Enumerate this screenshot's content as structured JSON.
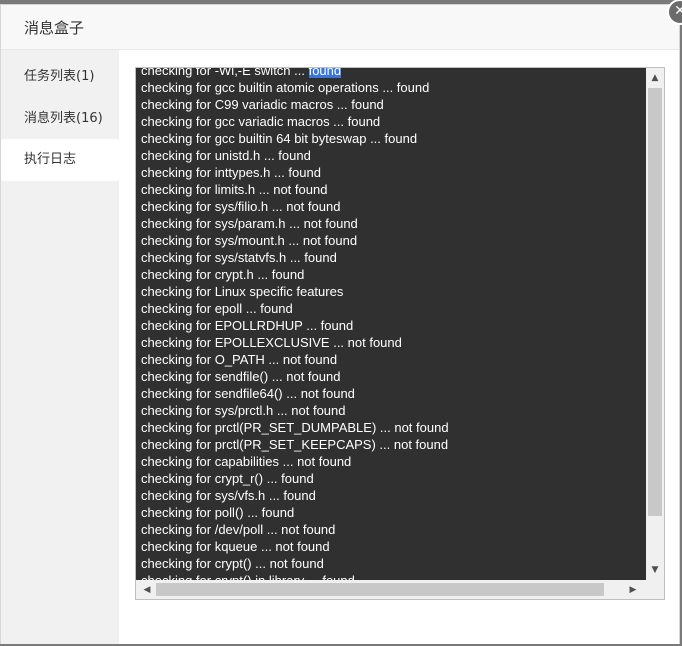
{
  "dialog": {
    "title": "消息盒子",
    "close_glyph": "✕"
  },
  "sidebar": {
    "items": [
      {
        "label": "任务列表(1)",
        "active": false
      },
      {
        "label": "消息列表(16)",
        "active": false
      },
      {
        "label": "执行日志",
        "active": true
      }
    ]
  },
  "log": {
    "partial_top_line": {
      "text": "checking for -Wl,-E switch ... ",
      "highlighted": "found"
    },
    "lines": [
      "checking for gcc builtin atomic operations ... found",
      "checking for C99 variadic macros ... found",
      "checking for gcc variadic macros ... found",
      "checking for gcc builtin 64 bit byteswap ... found",
      "checking for unistd.h ... found",
      "checking for inttypes.h ... found",
      "checking for limits.h ... not found",
      "checking for sys/filio.h ... not found",
      "checking for sys/param.h ... not found",
      "checking for sys/mount.h ... not found",
      "checking for sys/statvfs.h ... found",
      "checking for crypt.h ... found",
      "checking for Linux specific features",
      "checking for epoll ... found",
      "checking for EPOLLRDHUP ... found",
      "checking for EPOLLEXCLUSIVE ... not found",
      "checking for O_PATH ... not found",
      "checking for sendfile() ... not found",
      "checking for sendfile64() ... not found",
      "checking for sys/prctl.h ... not found",
      "checking for prctl(PR_SET_DUMPABLE) ... not found",
      "checking for prctl(PR_SET_KEEPCAPS) ... not found",
      "checking for capabilities ... not found",
      "checking for crypt_r() ... found",
      "checking for sys/vfs.h ... found",
      "checking for poll() ... found",
      "checking for /dev/poll ... not found",
      "checking for kqueue ... not found",
      "checking for crypt() ... not found"
    ],
    "partial_bottom_line": "checking for crypt() in library ... found"
  },
  "colors": {
    "log_background": "#303030",
    "log_text": "#ffffff",
    "selection": "#3a75d9",
    "sidebar_background": "#f1f1f1"
  },
  "icons": {
    "close": "close-icon",
    "scroll_up": "scroll-up-arrow-icon",
    "scroll_down": "scroll-down-arrow-icon",
    "scroll_left": "scroll-left-arrow-icon",
    "scroll_right": "scroll-right-arrow-icon"
  }
}
